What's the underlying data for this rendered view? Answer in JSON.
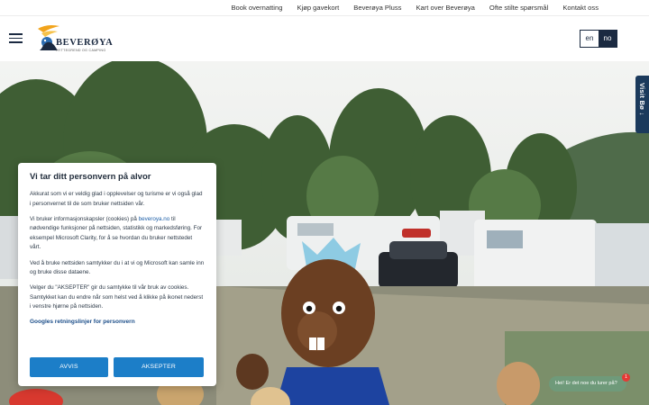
{
  "top_nav": {
    "items": [
      "Book overnatting",
      "Kjøp gavekort",
      "Beverøya Pluss",
      "Kart over Beverøya",
      "Ofte stilte spørsmål",
      "Kontakt oss"
    ]
  },
  "header": {
    "logo_text": "BEVERØYA",
    "logo_sub": "HYTTEGREND OG CAMPING",
    "lang_en": "en",
    "lang_no": "no"
  },
  "side_tab": {
    "label": "Visit Bø ↓"
  },
  "cookie": {
    "title": "Vi tar ditt personvern på alvor",
    "p1": "Akkurat som vi er veldig glad i opplevelser og turisme er vi også glad i personvernet til de som bruker nettsiden vår.",
    "p2_before": "Vi bruker informasjonskapsler (cookies) på ",
    "p2_link": "beveroya.no",
    "p2_after": " til nødvendige funksjoner på nettsiden, statistikk og markedsføring. For eksempel Microsoft Clarity, for å se hvordan du bruker nettstedet vårt.",
    "p3": "Ved å bruke nettsiden samtykker du i at vi og Microsoft kan samle inn og bruke disse dataene.",
    "p4": "Velger du \"AKSEPTER\" gir du samtykke til vår bruk av cookies. Samtykket kan du endre når som helst ved å klikke på ikonet nederst i venstre hjørne på nettsiden.",
    "policy_link": "Googles retningslinjer for personvern",
    "reject": "AVVIS",
    "accept": "AKSEPTER"
  },
  "chat": {
    "text": "Hei! Er det noe du lurer på?",
    "badge": "1"
  },
  "colors": {
    "navy": "#1b2a41",
    "button_blue": "#1c7ec8",
    "chat_green": "#6f9a7a"
  }
}
